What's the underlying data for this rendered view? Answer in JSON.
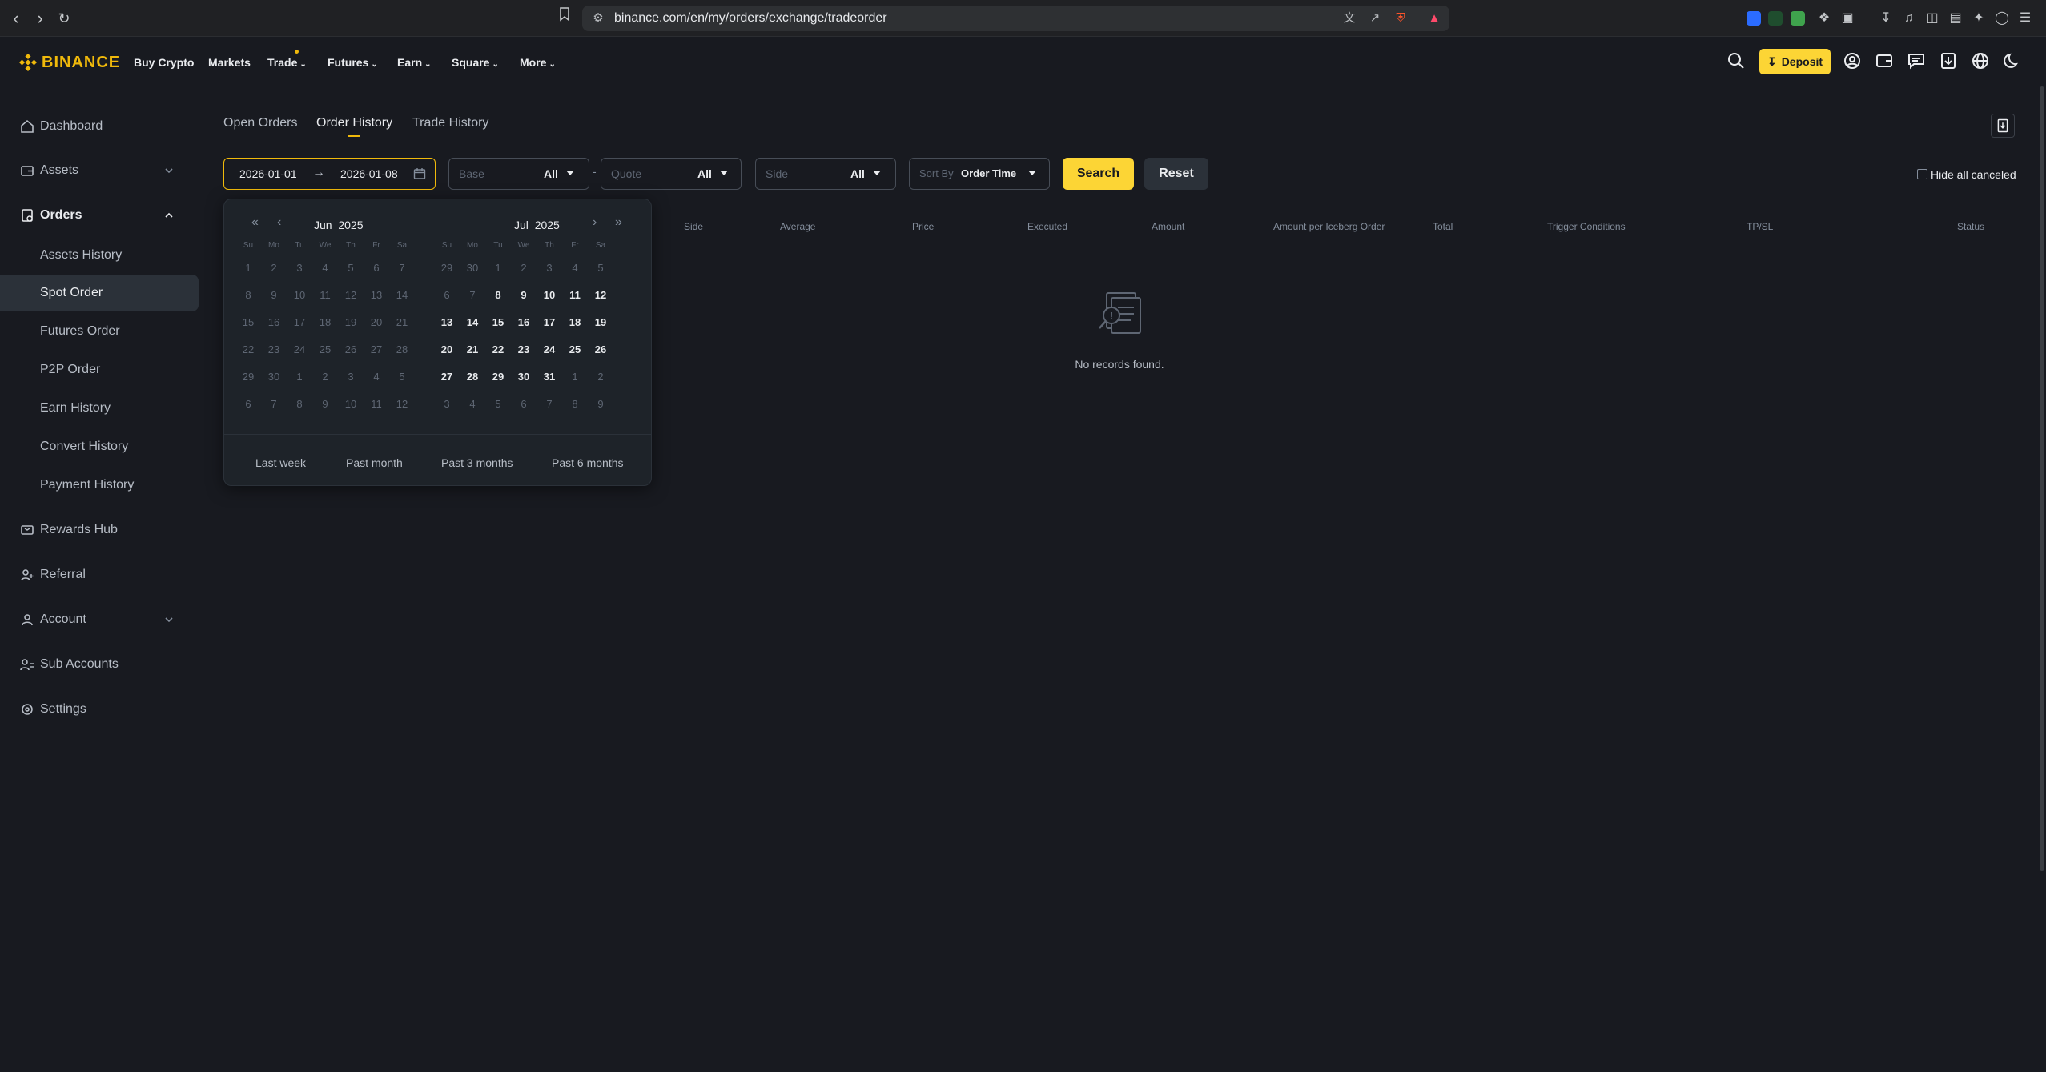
{
  "browser": {
    "url": "binance.com/en/my/orders/exchange/tradeorder",
    "brave_badge": "2",
    "alert_badge": "3"
  },
  "brand": {
    "name": "BINANCE",
    "accent": "#f0b90b",
    "bg": "#181a20"
  },
  "nav": {
    "items": [
      "Buy Crypto",
      "Markets",
      "Trade",
      "Futures",
      "Earn",
      "Square",
      "More"
    ],
    "deposit_label": "Deposit"
  },
  "sidebar": {
    "items": [
      {
        "label": "Dashboard",
        "icon": "home-icon"
      },
      {
        "label": "Assets",
        "icon": "wallet-icon"
      },
      {
        "label": "Orders",
        "icon": "orders-icon"
      },
      {
        "label": "Rewards Hub",
        "icon": "ticket-icon"
      },
      {
        "label": "Referral",
        "icon": "user-plus-icon"
      },
      {
        "label": "Account",
        "icon": "user-icon"
      },
      {
        "label": "Sub Accounts",
        "icon": "users-icon"
      },
      {
        "label": "Settings",
        "icon": "gear-icon"
      }
    ],
    "orders_sub": [
      "Assets History",
      "Spot Order",
      "Futures Order",
      "P2P Order",
      "Earn History",
      "Convert History",
      "Payment History"
    ],
    "active_sub": "Spot Order"
  },
  "tabs": [
    "Open Orders",
    "Order History",
    "Trade History"
  ],
  "active_tab": "Order History",
  "filters": {
    "date_start": "2026-01-01",
    "date_end": "2026-01-08",
    "base_placeholder": "Base",
    "base_value": "All",
    "quote_placeholder": "Quote",
    "quote_value": "All",
    "side_placeholder": "Side",
    "side_value": "All",
    "sort_prefix": "Sort By",
    "sort_value": "Order Time",
    "search_label": "Search",
    "reset_label": "Reset",
    "hide_canceled_label": "Hide all canceled"
  },
  "table": {
    "headers": [
      "Side",
      "Average",
      "Price",
      "Executed",
      "Amount",
      "Amount per Iceberg Order",
      "Total",
      "Trigger Conditions",
      "TP/SL",
      "Status"
    ],
    "empty_text": "No records found."
  },
  "picker": {
    "weekdays": [
      "Su",
      "Mo",
      "Tu",
      "We",
      "Th",
      "Fr",
      "Sa"
    ],
    "left": {
      "month": "Jun",
      "year": "2025",
      "days": [
        [
          "1",
          "2",
          "3",
          "4",
          "5",
          "6",
          "7"
        ],
        [
          "8",
          "9",
          "10",
          "11",
          "12",
          "13",
          "14"
        ],
        [
          "15",
          "16",
          "17",
          "18",
          "19",
          "20",
          "21"
        ],
        [
          "22",
          "23",
          "24",
          "25",
          "26",
          "27",
          "28"
        ],
        [
          "29",
          "30",
          "1",
          "2",
          "3",
          "4",
          "5"
        ],
        [
          "6",
          "7",
          "8",
          "9",
          "10",
          "11",
          "12"
        ]
      ],
      "current_from": 99,
      "current_to": -1
    },
    "right": {
      "month": "Jul",
      "year": "2025",
      "days": [
        [
          "29",
          "30",
          "1",
          "2",
          "3",
          "4",
          "5"
        ],
        [
          "6",
          "7",
          "8",
          "9",
          "10",
          "11",
          "12"
        ],
        [
          "13",
          "14",
          "15",
          "16",
          "17",
          "18",
          "19"
        ],
        [
          "20",
          "21",
          "22",
          "23",
          "24",
          "25",
          "26"
        ],
        [
          "27",
          "28",
          "29",
          "30",
          "31",
          "1",
          "2"
        ],
        [
          "3",
          "4",
          "5",
          "6",
          "7",
          "8",
          "9"
        ]
      ],
      "current_from": 9,
      "current_to": 32
    },
    "presets": [
      "Last week",
      "Past month",
      "Past 3 months",
      "Past 6 months"
    ]
  }
}
